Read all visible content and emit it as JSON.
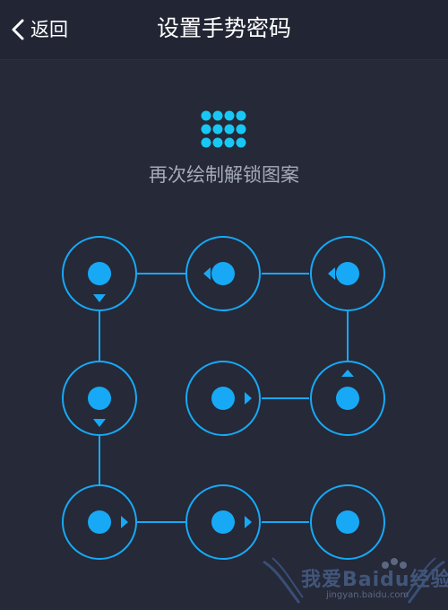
{
  "header": {
    "back_label": "返回",
    "title": "设置手势密码"
  },
  "main": {
    "prompt": "再次绘制解锁图案"
  },
  "pattern": {
    "accent": "#17a9f5",
    "background": "#252938",
    "grid": "3x3",
    "path_nodes": [
      5,
      6,
      3,
      2,
      1,
      4,
      7,
      8,
      9
    ],
    "filled_icon": "dots-grid-icon"
  },
  "watermark": {
    "text": "我爱Baidu经验",
    "url": "jingyan.baidu.com"
  },
  "colors": {
    "topbar": "#222634",
    "text_primary": "#ffffff",
    "text_secondary": "#a5abb8"
  }
}
